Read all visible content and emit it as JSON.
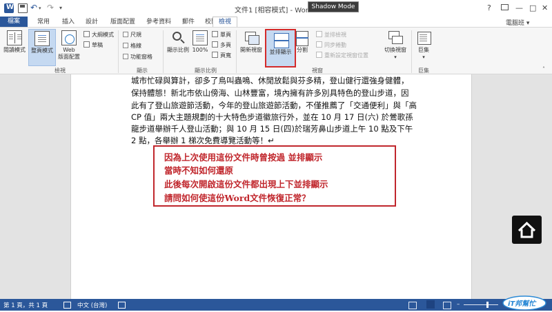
{
  "window": {
    "title": "文件1 [相容模式] - Word",
    "overlay_label": "Shadow Mode",
    "controls": [
      "?",
      "—",
      "□",
      "✕"
    ]
  },
  "tabs": [
    {
      "label": "檔案"
    },
    {
      "label": "常用"
    },
    {
      "label": "插入"
    },
    {
      "label": "設計"
    },
    {
      "label": "版面配置"
    },
    {
      "label": "參考資料"
    },
    {
      "label": "郵件"
    },
    {
      "label": "校閱"
    },
    {
      "label": "檢視",
      "active": true
    }
  ],
  "account": "電腦班 ▾",
  "ribbon": {
    "views_group": {
      "label": "檢視",
      "read_mode": "閱讀模式",
      "print_layout": "整頁模式",
      "web_layout_1": "Web",
      "web_layout_2": "版面配置",
      "outline": "大綱模式",
      "draft": "草稿"
    },
    "show_group": {
      "label": "顯示",
      "ruler": "尺規",
      "gridlines": "格線",
      "nav_pane": "功能窗格"
    },
    "zoom_group": {
      "label": "顯示比例",
      "zoom": "顯示比例",
      "hundred": "100%",
      "one_page": "單頁",
      "multi_page": "多頁",
      "page_width": "頁寬"
    },
    "window_group": {
      "label": "視窗",
      "new_window": "開新視窗",
      "arrange_all": "並排顯示",
      "split": "分割",
      "side_by_side": "並排檢視",
      "sync_scroll": "同步捲動",
      "reset_pos": "重新設定視窗位置",
      "switch_windows": "切換視窗"
    },
    "macros_group": {
      "label": "巨集",
      "macros": "巨集"
    }
  },
  "document": {
    "lines": [
      "城市忙碌與算計，卻多了鳥叫蟲鳴、休閒放鬆與芬多精，登山健行還強身健體，",
      "保持體態！新北市依山傍海、山林豐富，境內擁有許多別具特色的登山步道，因",
      "此有了登山旅遊節活動，今年的登山旅遊節活動，不僅推薦了「交通便利」與「高",
      "CP 值」兩大主題規劃的十大特色步道徽旅行外，並在 10 月 17 日(六) 於鶯歌孫",
      "龍步道舉辦千人登山活動；與 10 月 15 日(四)於瑞芳鼻山步道上午 10 點及下午",
      "2 點，各舉辦 1 梯次免費導覽活動等！↵"
    ]
  },
  "callout": {
    "lines": [
      "因為上次使用這份文件時曾按過 並排顯示",
      "當時不知如何還原",
      "此後每次開啟這份文件都出現上下並排顯示",
      "請問如何使這份Word文件恢復正常？"
    ]
  },
  "statusbar": {
    "page": "第 1 頁，共 1 頁",
    "language": "中文 (台灣)",
    "zoom_percent": 100,
    "logo_text": "iT邦幫忙"
  },
  "colors": {
    "brand": "#2b579a",
    "callout": "#c0262c",
    "highlight_box": "#d42a2a"
  }
}
